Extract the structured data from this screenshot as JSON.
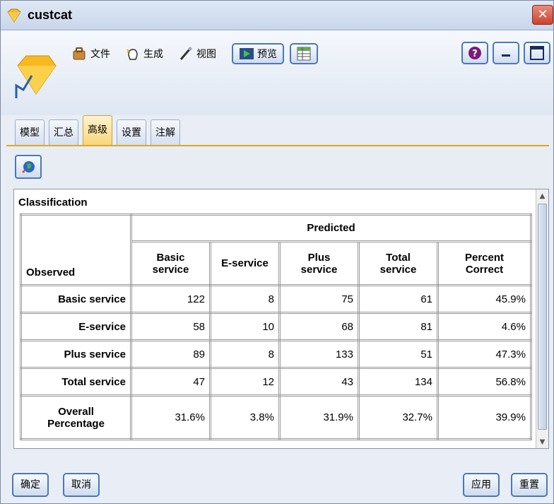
{
  "window": {
    "title": "custcat",
    "close_label": "✕"
  },
  "toolbar": {
    "file_label": "文件",
    "generate_label": "生成",
    "view_label": "视图",
    "preview_label": "预览"
  },
  "tabs": [
    {
      "label": "模型"
    },
    {
      "label": "汇总"
    },
    {
      "label": "高级",
      "active": true
    },
    {
      "label": "设置"
    },
    {
      "label": "注解"
    }
  ],
  "table": {
    "title": "Classification",
    "observed_header": "Observed",
    "predicted_header": "Predicted",
    "columns": [
      "Basic\nservice",
      "E-service",
      "Plus\nservice",
      "Total\nservice",
      "Percent\nCorrect"
    ],
    "rows": [
      {
        "label": "Basic service",
        "values": [
          "122",
          "8",
          "75",
          "61",
          "45.9%"
        ]
      },
      {
        "label": "E-service",
        "values": [
          "58",
          "10",
          "68",
          "81",
          "4.6%"
        ]
      },
      {
        "label": "Plus service",
        "values": [
          "89",
          "8",
          "133",
          "51",
          "47.3%"
        ]
      },
      {
        "label": "Total service",
        "values": [
          "47",
          "12",
          "43",
          "134",
          "56.8%"
        ]
      },
      {
        "label": "Overall\nPercentage",
        "values": [
          "31.6%",
          "3.8%",
          "31.9%",
          "32.7%",
          "39.9%"
        ]
      }
    ]
  },
  "footer": {
    "ok_label": "确定",
    "cancel_label": "取消",
    "apply_label": "应用",
    "reset_label": "重置"
  }
}
